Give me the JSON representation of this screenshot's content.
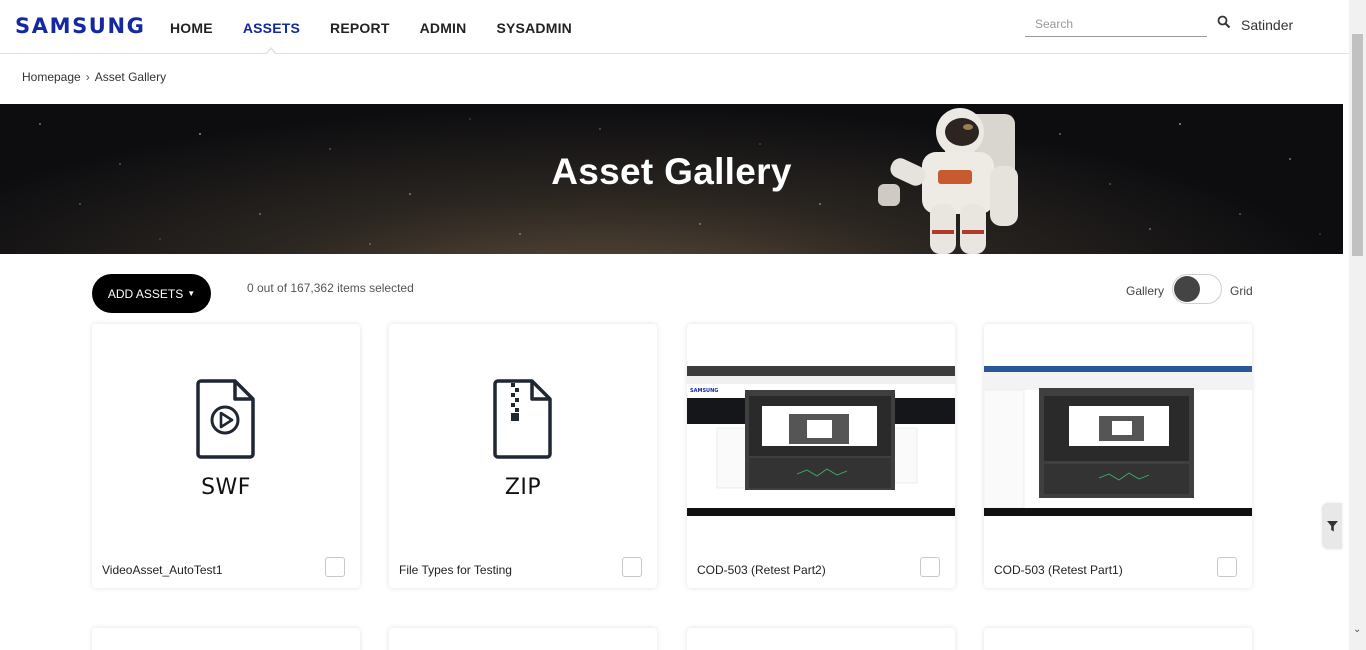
{
  "header": {
    "logo": "SAMSUNG",
    "nav": [
      {
        "label": "HOME",
        "active": false
      },
      {
        "label": "ASSETS",
        "active": true
      },
      {
        "label": "REPORT",
        "active": false
      },
      {
        "label": "ADMIN",
        "active": false
      },
      {
        "label": "SYSADMIN",
        "active": false
      }
    ],
    "search_placeholder": "Search",
    "search_value": "",
    "user": "Satinder"
  },
  "breadcrumb": {
    "home": "Homepage",
    "current": "Asset Gallery"
  },
  "banner": {
    "title": "Asset Gallery"
  },
  "toolbar": {
    "add_assets_label": "ADD ASSETS",
    "selection_text": "0 out of 167,362 items selected",
    "view_left_label": "Gallery",
    "view_right_label": "Grid"
  },
  "cards": [
    {
      "type": "file",
      "icon": "video-file-icon",
      "file_type": "SWF",
      "title": "VideoAsset_AutoTest1",
      "checked": false
    },
    {
      "type": "file",
      "icon": "zip-file-icon",
      "file_type": "ZIP",
      "title": "File Types for Testing",
      "checked": false
    },
    {
      "type": "image",
      "icon": "screenshot-thumbnail",
      "title": "COD-503 (Retest Part2)",
      "checked": false
    },
    {
      "type": "image",
      "icon": "screenshot-thumbnail",
      "title": "COD-503 (Retest Part1)",
      "checked": false
    }
  ],
  "colors": {
    "brand": "#1428a0",
    "button_bg": "#000000",
    "toggle_knob": "#444444"
  }
}
